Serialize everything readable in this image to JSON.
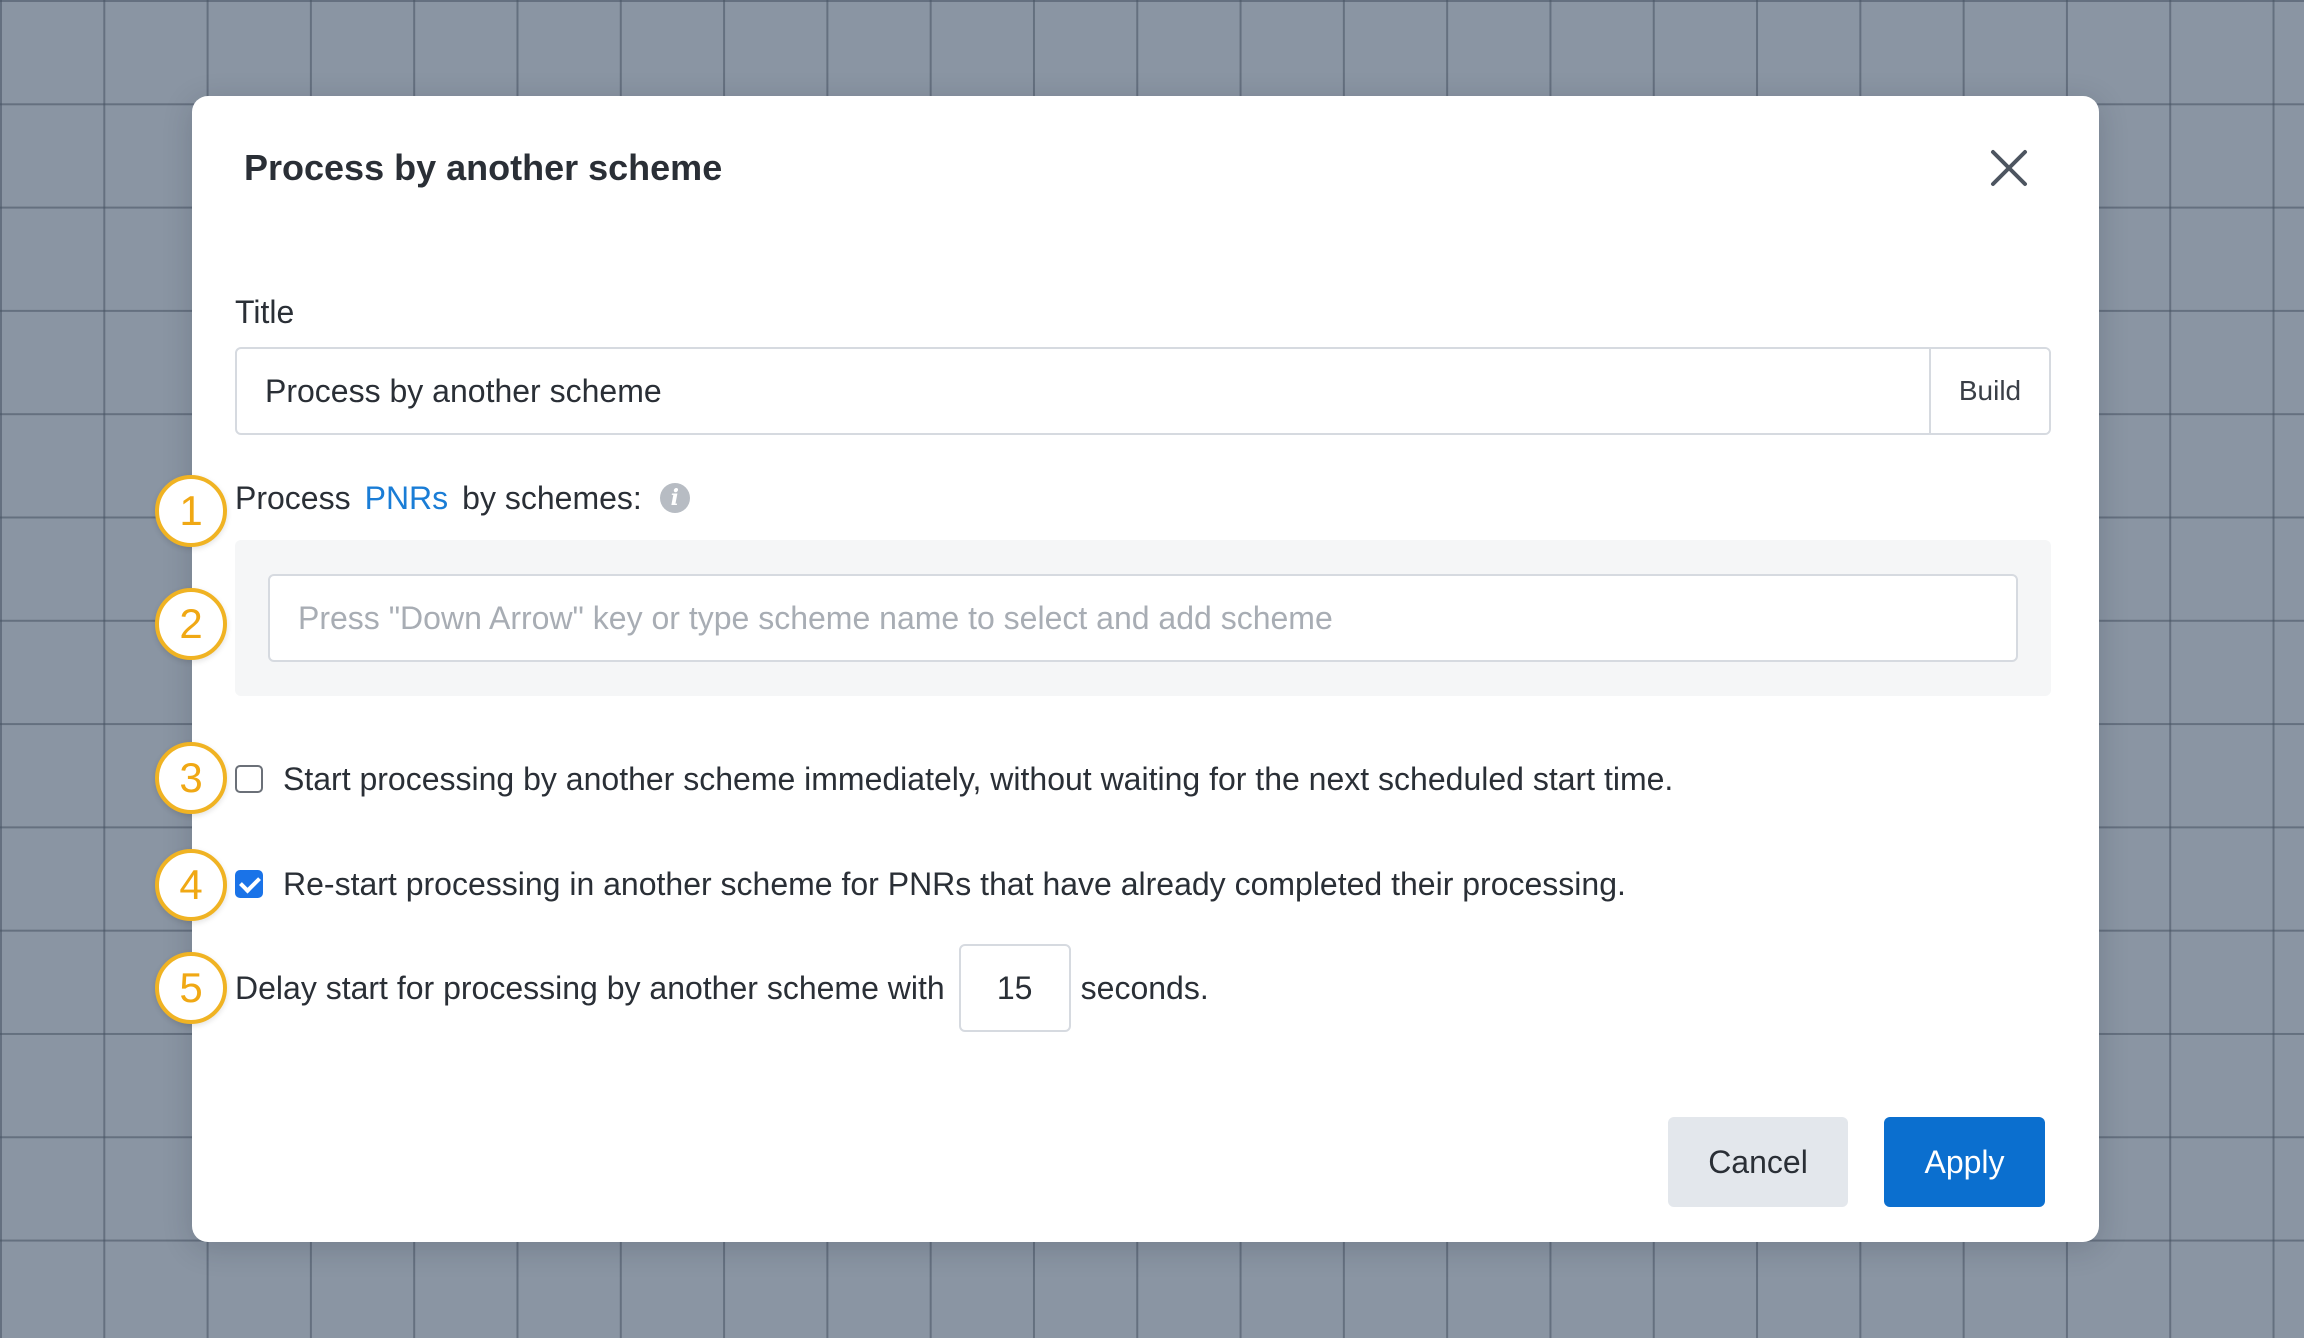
{
  "dialog": {
    "title": "Process by another scheme",
    "close_icon": "close-icon"
  },
  "title_field": {
    "label": "Title",
    "value": "Process by another scheme",
    "build_label": "Build"
  },
  "schemes": {
    "label_prefix": "Process",
    "label_link": "PNRs",
    "label_suffix": "by schemes:",
    "info_icon": "info-icon",
    "placeholder": "Press \"Down Arrow\" key or type scheme name to select and add scheme"
  },
  "options": {
    "start_immediately": {
      "label": "Start processing by another scheme immediately, without waiting for the next scheduled start time.",
      "checked": false
    },
    "restart_completed": {
      "label": "Re-start processing in another scheme for PNRs that have already completed their processing.",
      "checked": true
    }
  },
  "delay": {
    "prefix": "Delay start for processing by another scheme with",
    "value": "15",
    "suffix": "seconds."
  },
  "buttons": {
    "cancel": "Cancel",
    "apply": "Apply"
  },
  "callouts": [
    "1",
    "2",
    "3",
    "4",
    "5"
  ],
  "colors": {
    "accent": "#0b6fcf",
    "link": "#1a7dd6",
    "callout": "#f0b323",
    "backdrop": "#8a95a3"
  }
}
